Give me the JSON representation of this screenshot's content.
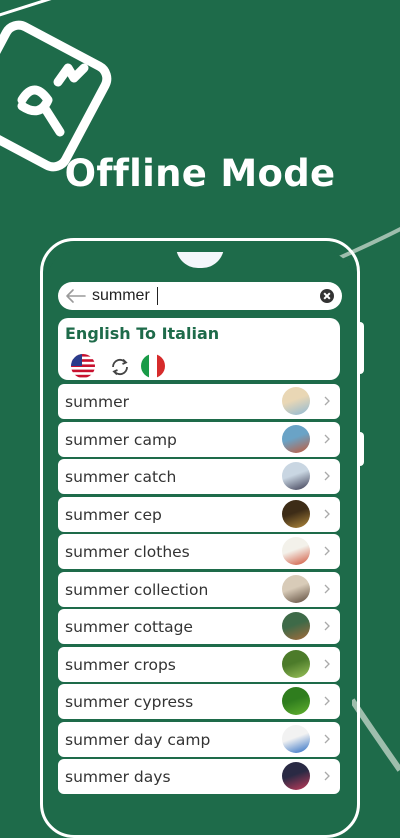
{
  "headline": "Offline Mode",
  "search": {
    "value": "summer",
    "placeholder": ""
  },
  "language": {
    "title": "English To Italian",
    "source_flag": "us-flag-icon",
    "swap_icon": "swap-icon",
    "target_flag": "italy-flag-icon"
  },
  "results": [
    {
      "label": "summer",
      "thumb": [
        "#e9d7b5",
        "#8fb9d4"
      ]
    },
    {
      "label": "summer camp",
      "thumb": [
        "#6aa3c6",
        "#c35a3a"
      ]
    },
    {
      "label": "summer catch",
      "thumb": [
        "#c9d6e2",
        "#3b3b52"
      ]
    },
    {
      "label": "summer cep",
      "thumb": [
        "#3d2c17",
        "#b38a3c"
      ]
    },
    {
      "label": "summer clothes",
      "thumb": [
        "#f3f1ea",
        "#d0533a"
      ]
    },
    {
      "label": "summer collection",
      "thumb": [
        "#d8cbb8",
        "#5c4a3b"
      ]
    },
    {
      "label": "summer cottage",
      "thumb": [
        "#3e6a48",
        "#a66b3b"
      ]
    },
    {
      "label": "summer crops",
      "thumb": [
        "#4c7b2a",
        "#9bc25a"
      ]
    },
    {
      "label": "summer cypress",
      "thumb": [
        "#2f7d1e",
        "#63b22f"
      ]
    },
    {
      "label": "summer day camp",
      "thumb": [
        "#f2f2f2",
        "#2a6bc2"
      ]
    },
    {
      "label": "summer days",
      "thumb": [
        "#2a2a44",
        "#c43b5a"
      ]
    }
  ],
  "colors": {
    "brand_green": "#1e6b4a",
    "card_bg": "#ffffff",
    "screen_bg": "#f4f6fb"
  }
}
